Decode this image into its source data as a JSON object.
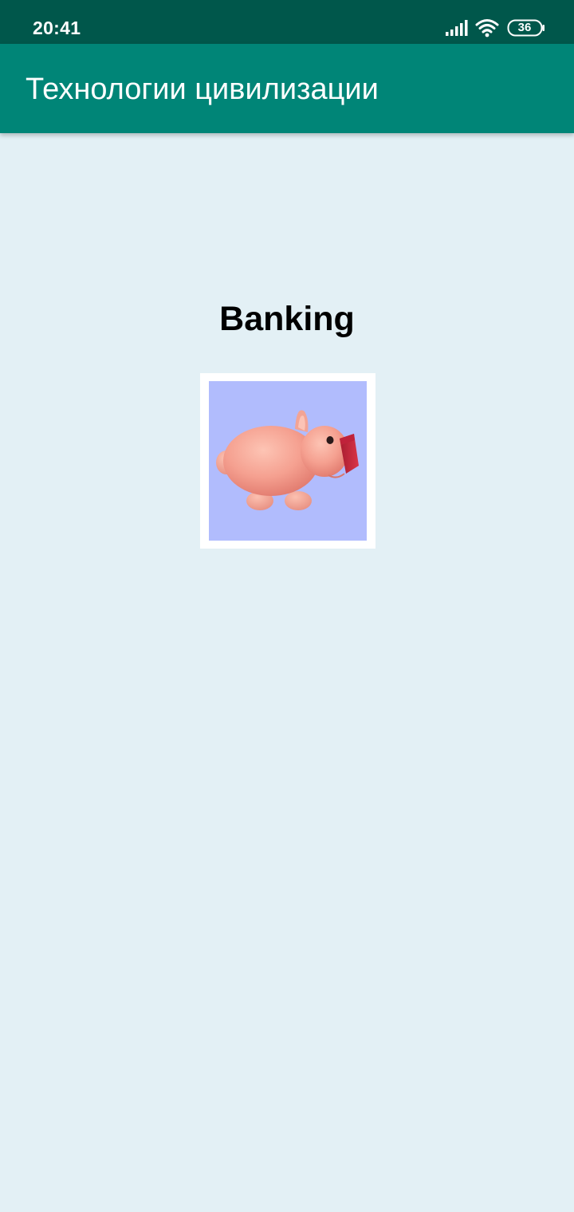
{
  "status_bar": {
    "time": "20:41",
    "battery_level": "36",
    "icons": [
      "signal-icon",
      "wifi-icon",
      "battery-icon"
    ]
  },
  "app_bar": {
    "title": "Технологии цивилизации"
  },
  "content": {
    "heading": "Banking",
    "image": "piggy-bank-image"
  },
  "colors": {
    "status_bar": "#00574b",
    "app_bar": "#008577",
    "background": "#e3f0f5",
    "image_background": "#b1bcfd",
    "pig_pink": "#f7a398",
    "pig_snout": "#c9283d"
  }
}
